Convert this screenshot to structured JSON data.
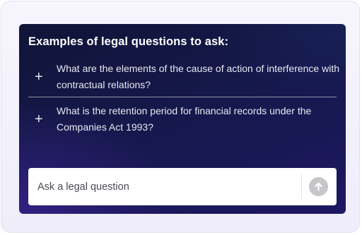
{
  "panel": {
    "heading": "Examples of legal questions to ask:",
    "questions": [
      {
        "icon": "plus-icon",
        "symbol": "+",
        "text": "What are the elements of the cause of action of interference with contractual relations?"
      },
      {
        "icon": "plus-icon",
        "symbol": "+",
        "text": "What is the retention period for financial records under the Companies Act 1993?"
      }
    ]
  },
  "ask": {
    "placeholder": "Ask a legal question",
    "value": "",
    "send_icon": "arrow-up-icon"
  },
  "colors": {
    "panel_bg_dark": "#101438",
    "panel_bg_purple": "#1d1762",
    "send_button_disabled": "#c6c6cb",
    "heading_text": "#ffffff",
    "question_text": "#e9e8f3"
  }
}
